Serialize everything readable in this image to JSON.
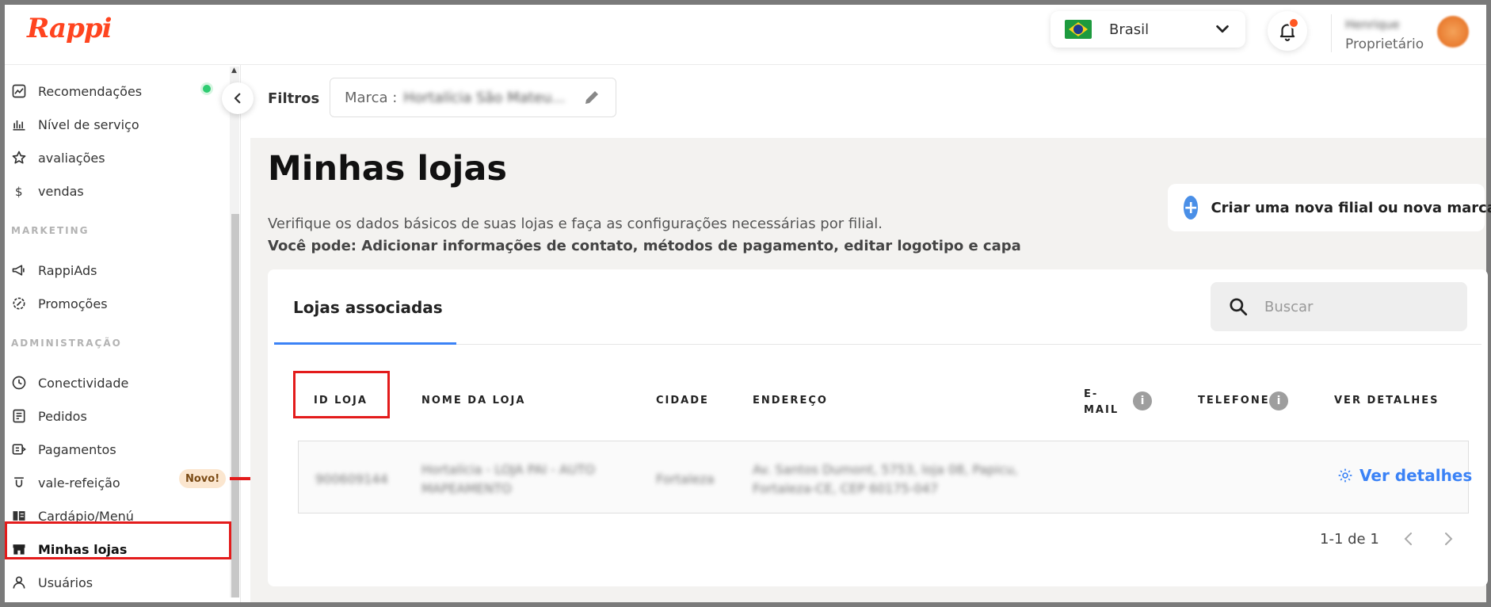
{
  "header": {
    "logo": "Rappi",
    "country": "Brasil",
    "user_name": "Henrique",
    "user_role": "Proprietário"
  },
  "sidebar": {
    "items_top": [
      {
        "label": "Recomendações",
        "icon": "chart-icon"
      },
      {
        "label": "Nível de serviço",
        "icon": "bars-icon"
      },
      {
        "label": "avaliações",
        "icon": "star-icon"
      },
      {
        "label": "vendas",
        "icon": "dollar-icon"
      }
    ],
    "section_marketing": "MARKETING",
    "items_marketing": [
      {
        "label": "RappiAds",
        "icon": "megaphone-icon"
      },
      {
        "label": "Promoções",
        "icon": "badge-icon"
      }
    ],
    "section_admin": "ADMINISTRAÇÃO",
    "items_admin": [
      {
        "label": "Conectividade",
        "icon": "clock-icon"
      },
      {
        "label": "Pedidos",
        "icon": "orders-icon"
      },
      {
        "label": "Pagamentos",
        "icon": "payment-icon"
      },
      {
        "label": "vale-refeição",
        "icon": "voucher-icon"
      },
      {
        "label": "Cardápio/Menú",
        "icon": "book-icon"
      },
      {
        "label": "Minhas lojas",
        "icon": "store-icon"
      },
      {
        "label": "Usuários",
        "icon": "user-icon"
      }
    ],
    "novo_badge": "Novo!"
  },
  "filters": {
    "label": "Filtros",
    "chip_prefix": "Marca :",
    "chip_value": "Hortalícia São Mateu..."
  },
  "page": {
    "title": "Minhas lojas",
    "description": "Verifique os dados básicos de suas lojas e faça as configurações necessárias por filial.",
    "description_bold": "Você pode: Adicionar informações de contato, métodos de pagamento, editar logotipo e capa",
    "create_button": "Criar uma nova filial ou nova marca"
  },
  "table": {
    "tab": "Lojas associadas",
    "search_placeholder": "Buscar",
    "headers": {
      "id": "ID LOJA",
      "name": "NOME DA LOJA",
      "city": "CIDADE",
      "address": "ENDEREÇO",
      "email_1": "E-",
      "email_2": "MAIL",
      "phone": "TELEFONE",
      "details": "VER DETALHES"
    },
    "row": {
      "id": "900609144",
      "name_1": "Hortalícia - LOJA PAI - AUTO",
      "name_2": "MAPEAMENTO",
      "city": "Fortaleza",
      "address_1": "Av. Santos Dumont, 5753, loja 08, Papicu,",
      "address_2": "Fortaleza-CE, CEP 60175-047",
      "details": "Ver detalhes"
    },
    "pagination": "1-1 de 1"
  },
  "colors": {
    "brand": "#ff441f",
    "link": "#3b82f6",
    "highlight": "#e31b1b"
  }
}
